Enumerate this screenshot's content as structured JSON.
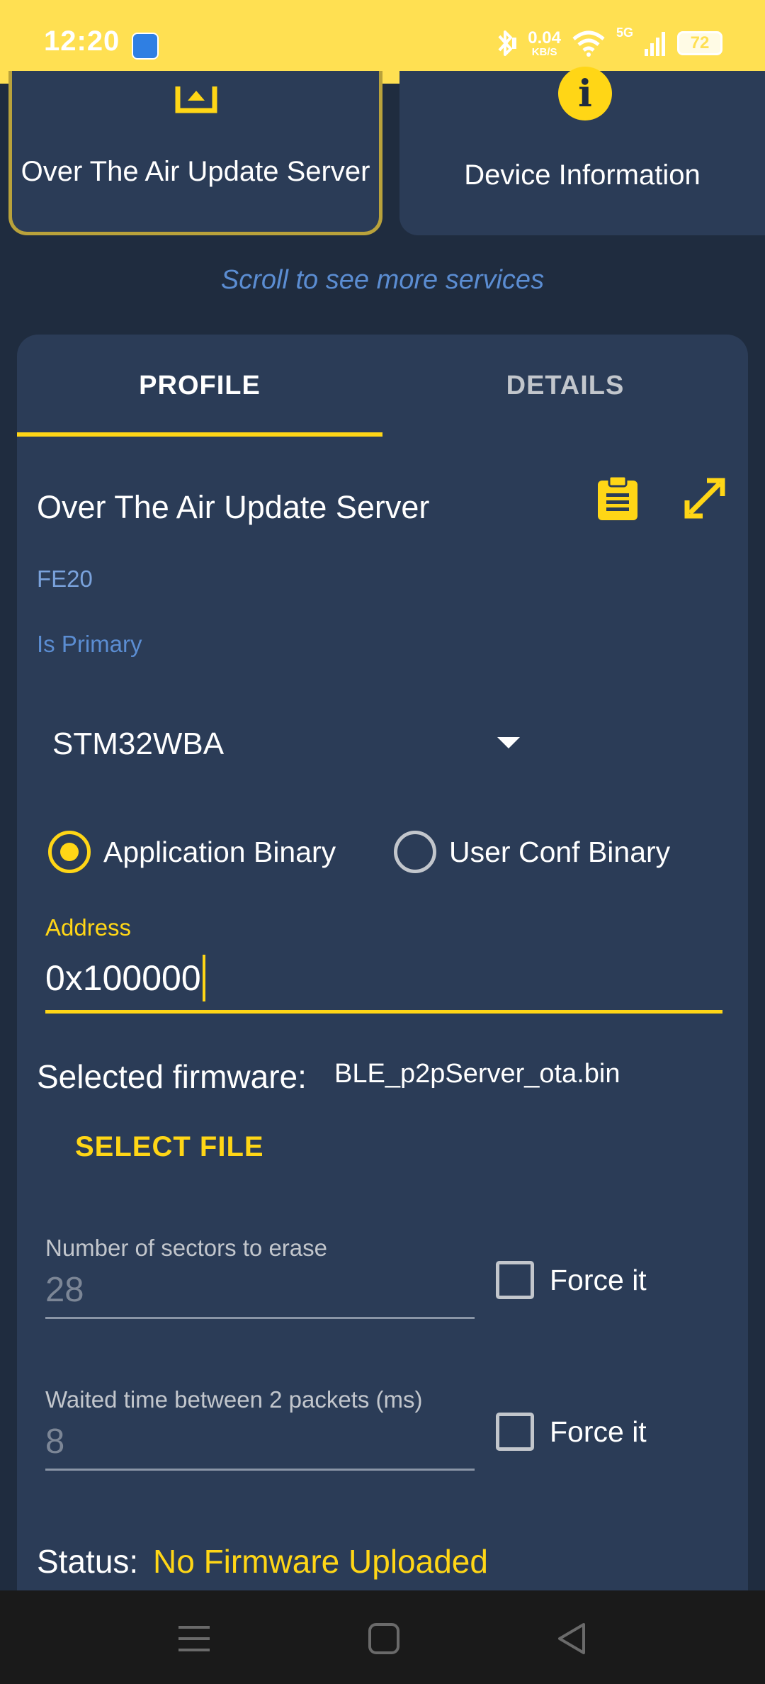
{
  "status_bar": {
    "time": "12:20",
    "speed_value": "0.04",
    "speed_unit": "KB/S",
    "network": "5G",
    "battery": "72"
  },
  "services": {
    "cards": [
      {
        "label": "Over The Air Update Server",
        "icon": "upload-tray-icon",
        "selected": true
      },
      {
        "label": "Device Information",
        "icon": "info-icon",
        "selected": false
      }
    ],
    "scroll_hint": "Scroll to see more services"
  },
  "tabs": {
    "profile": "PROFILE",
    "details": "DETAILS",
    "active": "profile"
  },
  "profile": {
    "service_title": "Over The Air Update Server",
    "uuid": "FE20",
    "primary_label": "Is Primary",
    "device_select": {
      "value": "STM32WBA"
    },
    "binary_type": {
      "options": [
        "Application Binary",
        "User Conf Binary"
      ],
      "selected": "Application Binary"
    },
    "address": {
      "label": "Address",
      "value": "0x100000"
    },
    "firmware": {
      "label": "Selected firmware:",
      "name": "BLE_p2pServer_ota.bin"
    },
    "select_file_label": "SELECT FILE",
    "sectors": {
      "label": "Number of sectors to erase",
      "value": "28",
      "force_label": "Force it",
      "force_checked": false
    },
    "wait_time": {
      "label": "Waited time between 2 packets (ms)",
      "value": "8",
      "force_label": "Force it",
      "force_checked": false
    },
    "status": {
      "label": "Status:",
      "value": "No Firmware Uploaded"
    }
  },
  "colors": {
    "accent": "#ffd616",
    "status_bar": "#ffe052",
    "background": "#1f2c3f",
    "panel": "#2b3c57",
    "link_blue": "#5b8dd2"
  }
}
